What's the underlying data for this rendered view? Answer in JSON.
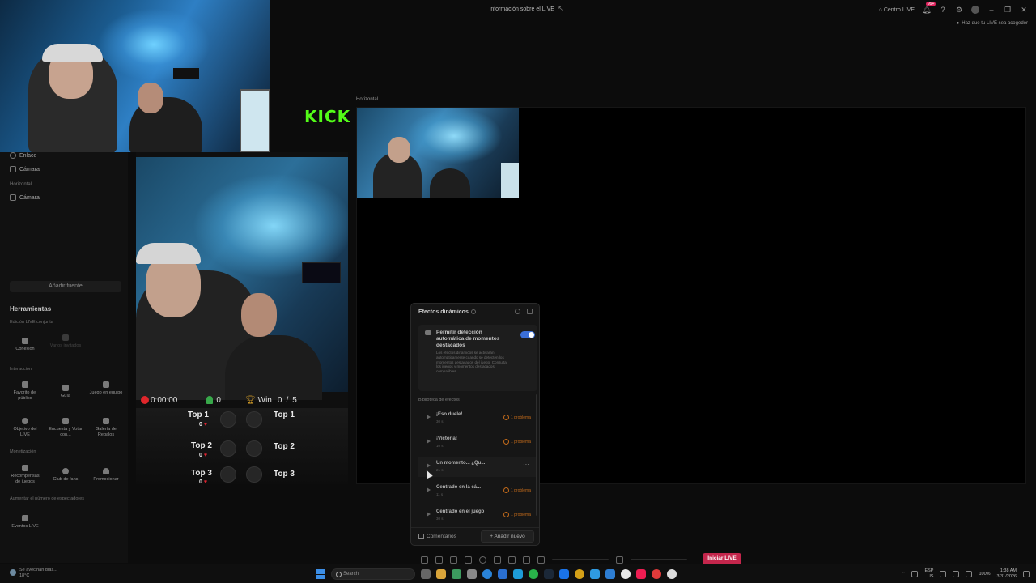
{
  "titlebar": {
    "title": "Información sobre el LIVE",
    "live_center": "Centro LIVE",
    "notif_count": "99+",
    "hint": "Haz que tu LIVE sea acogedor"
  },
  "kick_logo": "KICK",
  "sidebar": {
    "items": [
      {
        "label": "Enlace",
        "icon": "globe-icon"
      },
      {
        "label": "Cámara",
        "icon": "camera-icon"
      }
    ],
    "horizontal_heading": "Horizontal",
    "horizontal_items": [
      {
        "label": "Cámara",
        "icon": "camera-icon"
      }
    ],
    "add_source": "Añadir fuente",
    "tools_title": "Herramientas",
    "sections": {
      "co_edit": "Edición LIVE conjunta",
      "interaction": "Interacción",
      "monetization": "Monetización",
      "viewers": "Aumentar el número de espectadores"
    },
    "tools": {
      "collab": "Conexión",
      "multi_guest": "Varios invitados",
      "favorite": "Favorito del público",
      "guide": "Guía",
      "team_game": "Juego en equipo",
      "live_goal": "Objetivo del LIVE",
      "poll": "Encuesta y Votar con...",
      "gift_gallery": "Galería de Regalos",
      "game_rewards": "Recompensas de juegos",
      "fan_club": "Club de fans",
      "promote": "Promocionar",
      "live_events": "Eventos LIVE"
    }
  },
  "vertical_preview": {
    "timer": "0:00:00",
    "viewers": "0",
    "win_label": "Win",
    "win_score": "0",
    "win_sep": "/",
    "win_total": "5",
    "tops": [
      {
        "label": "Top 1",
        "score": "0"
      },
      {
        "label": "Top 2",
        "score": "0"
      },
      {
        "label": "Top 3",
        "score": "0"
      }
    ],
    "tops_right": [
      "Top 1",
      "Top 2",
      "Top 3"
    ]
  },
  "horizontal_preview": {
    "label": "Horizontal"
  },
  "effects_panel": {
    "title": "Efectos dinámicos",
    "detect_title": "Permitir detección automática de momentos destacados",
    "detect_desc": "Los efectos dinámicos se activarán automáticamente cuando se detecten los momentos destacados del juego. Consulta los juegos y momentos destacados compatibles",
    "toggle_on": true,
    "library_title": "Biblioteca de efectos",
    "effects": [
      {
        "name": "¡Eso duele!",
        "duration": "30 s",
        "warning": "1 problema"
      },
      {
        "name": "¡Victoria!",
        "duration": "10 s",
        "warning": "1 problema"
      },
      {
        "name": "Un momento... ¿Qu...",
        "duration": "21 s",
        "warning": ""
      },
      {
        "name": "Centrado en la cá...",
        "duration": "11 s",
        "warning": "1 problema"
      },
      {
        "name": "Centrado en el juego",
        "duration": "30 s",
        "warning": "1 problema"
      }
    ],
    "comments": "Comentarios",
    "add_new": "+ Añadir nuevo"
  },
  "go_live": "Iniciar LIVE",
  "taskbar": {
    "weather_text": "Se avecinan días...",
    "temp": "18°C",
    "search_placeholder": "Search",
    "lang": "ESP",
    "region": "US",
    "battery": "100%",
    "time": "1:38 AM",
    "date": "3/31/2026"
  },
  "colors": {
    "accent_blue": "#3b6fd8",
    "go_live": "#c4264c",
    "warning": "#c26a1a",
    "kick_green": "#53fc18",
    "rec_red": "#e0262b"
  }
}
